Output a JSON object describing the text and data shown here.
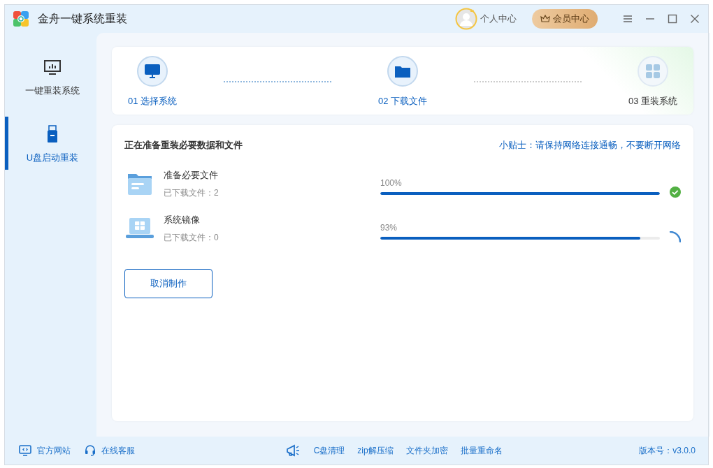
{
  "window": {
    "title": "金舟一键系统重装"
  },
  "header": {
    "user_label": "个人中心",
    "vip_button": "会员中心"
  },
  "sidebar": {
    "items": [
      {
        "label": "一键重装系统",
        "selected": false
      },
      {
        "label": "U盘启动重装",
        "selected": true
      }
    ]
  },
  "steps": [
    {
      "label": "01 选择系统",
      "reached": true
    },
    {
      "label": "02 下载文件",
      "reached": true
    },
    {
      "label": "03 重装系统",
      "reached": false
    }
  ],
  "task": {
    "title": "正在准备重装必要数据和文件",
    "tip": "小贴士：请保持网络连接通畅，不要断开网络",
    "items": [
      {
        "name": "准备必要文件",
        "detail": "已下载文件：2",
        "percent": "100%",
        "level": 1.0,
        "kind": "done"
      },
      {
        "name": "系统镜像",
        "detail": "已下载文件：0",
        "percent": "93%",
        "level": 0.93,
        "kind": "loading"
      }
    ],
    "cancel_button": "取消制作"
  },
  "footer": {
    "left": [
      {
        "label": "官方网站"
      },
      {
        "label": "在线客服"
      }
    ],
    "tools": [
      "C盘清理",
      "zip解压缩",
      "文件夹加密",
      "批量重命名"
    ],
    "version": "版本号：v3.0.0"
  }
}
